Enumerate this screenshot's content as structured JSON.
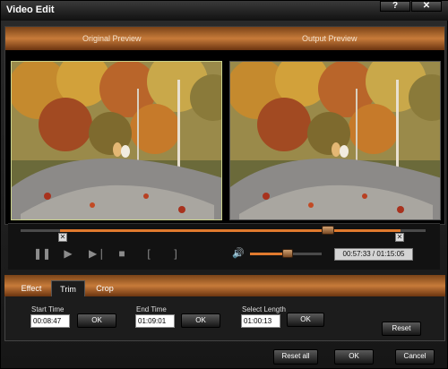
{
  "window": {
    "title": "Video Edit"
  },
  "titlebar": {
    "help_label": "?",
    "close_label": "✕"
  },
  "preview": {
    "original_label": "Original Preview",
    "output_label": "Output Preview"
  },
  "timeline": {
    "time_display": "00:57:33 / 01:15:05",
    "controls": {
      "pause": "❚❚",
      "play": "▶",
      "next_frame": "▶❘",
      "stop": "■",
      "mark_in": "[",
      "mark_out": "]"
    },
    "marker_glyph": "✕",
    "volume_glyph": "🔊"
  },
  "tabs": [
    "Effect",
    "Trim",
    "Crop"
  ],
  "trim": {
    "start_time_label": "Start Time",
    "start_time_value": "00:08:47",
    "end_time_label": "End Time",
    "end_time_value": "01:09:01",
    "select_length_label": "Select Length",
    "select_length_value": "01:00:13",
    "ok_label": "OK",
    "reset_label": "Reset"
  },
  "footer": {
    "reset_all_label": "Reset all",
    "ok_label": "OK",
    "cancel_label": "Cancel"
  },
  "colors": {
    "accent": "#e07a2e",
    "header_gradient_mid": "#c77b3a",
    "selection_border": "#c8d08a"
  }
}
